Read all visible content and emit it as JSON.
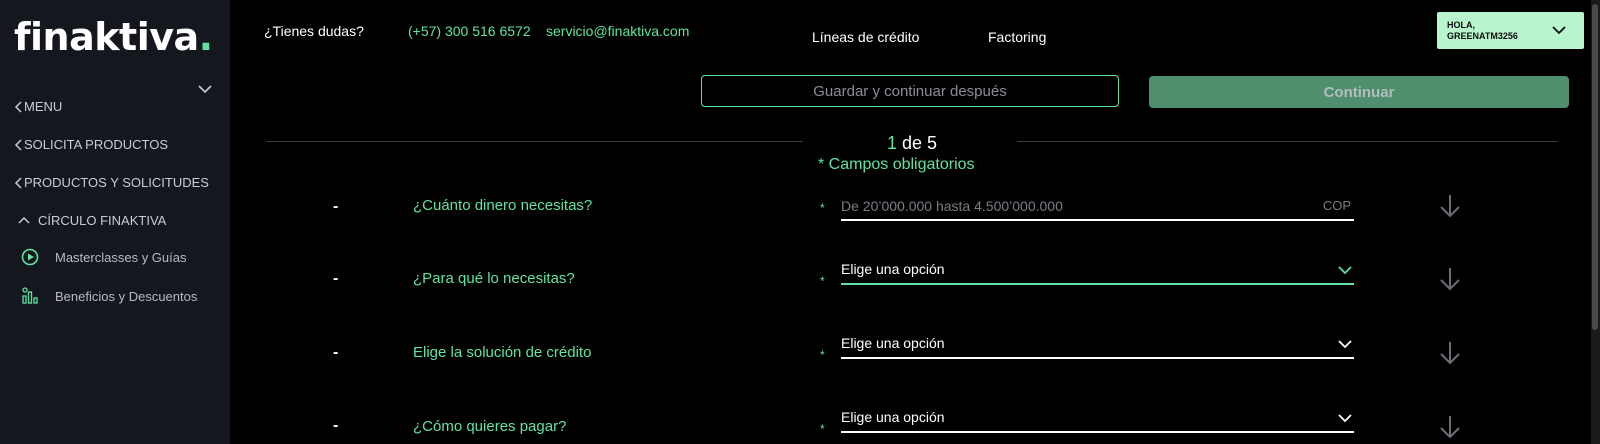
{
  "sidebar": {
    "logo": "finaktiva",
    "logo_dot": ".",
    "menu_label": "MENU",
    "items": [
      {
        "label": "SOLICITA PRODUCTOS"
      },
      {
        "label": "PRODUCTOS Y SOLICITUDES"
      }
    ],
    "circulo": {
      "label": "CÍRCULO FINAKTIVA",
      "sub_items": [
        {
          "label": "Masterclasses y Guías",
          "icon": "play-circle-icon"
        },
        {
          "label": "Beneficios y Descuentos",
          "icon": "benefits-chart-icon"
        }
      ]
    }
  },
  "header": {
    "dudas": "¿Tienes dudas?",
    "phone": "(+57) 300 516 6572",
    "email": "servicio@finaktiva.com",
    "nav": [
      "Líneas de crédito",
      "Factoring"
    ],
    "user_greeting": "HOLA,",
    "user_name": "GREENATM3256"
  },
  "actions": {
    "save_label": "Guardar y continuar después",
    "continue_label": "Continuar"
  },
  "step": {
    "current": "1",
    "suffix": " de 5",
    "required_note": "* Campos obligatorios"
  },
  "form": {
    "rows": [
      {
        "dash": "-",
        "label": "¿Cuánto dinero necesitas?",
        "star": "*",
        "placeholder": "De 20’000.000 hasta 4.500’000.000",
        "suffix": "COP"
      },
      {
        "dash": "-",
        "label": "¿Para qué lo necesitas?",
        "star": "*",
        "value": "Elige una opción"
      },
      {
        "dash": "-",
        "label": "Elige la solución de crédito",
        "star": "*",
        "value": "Elige una opción"
      },
      {
        "dash": "-",
        "label": "¿Cómo quieres pagar?",
        "star": "*",
        "value": "Elige una opción"
      }
    ]
  },
  "colors": {
    "accent": "#5fe3a1",
    "sidebar_bg": "#15171f",
    "continue_bg": "#4f8f6d",
    "user_box_bg": "#b8f5cf"
  }
}
